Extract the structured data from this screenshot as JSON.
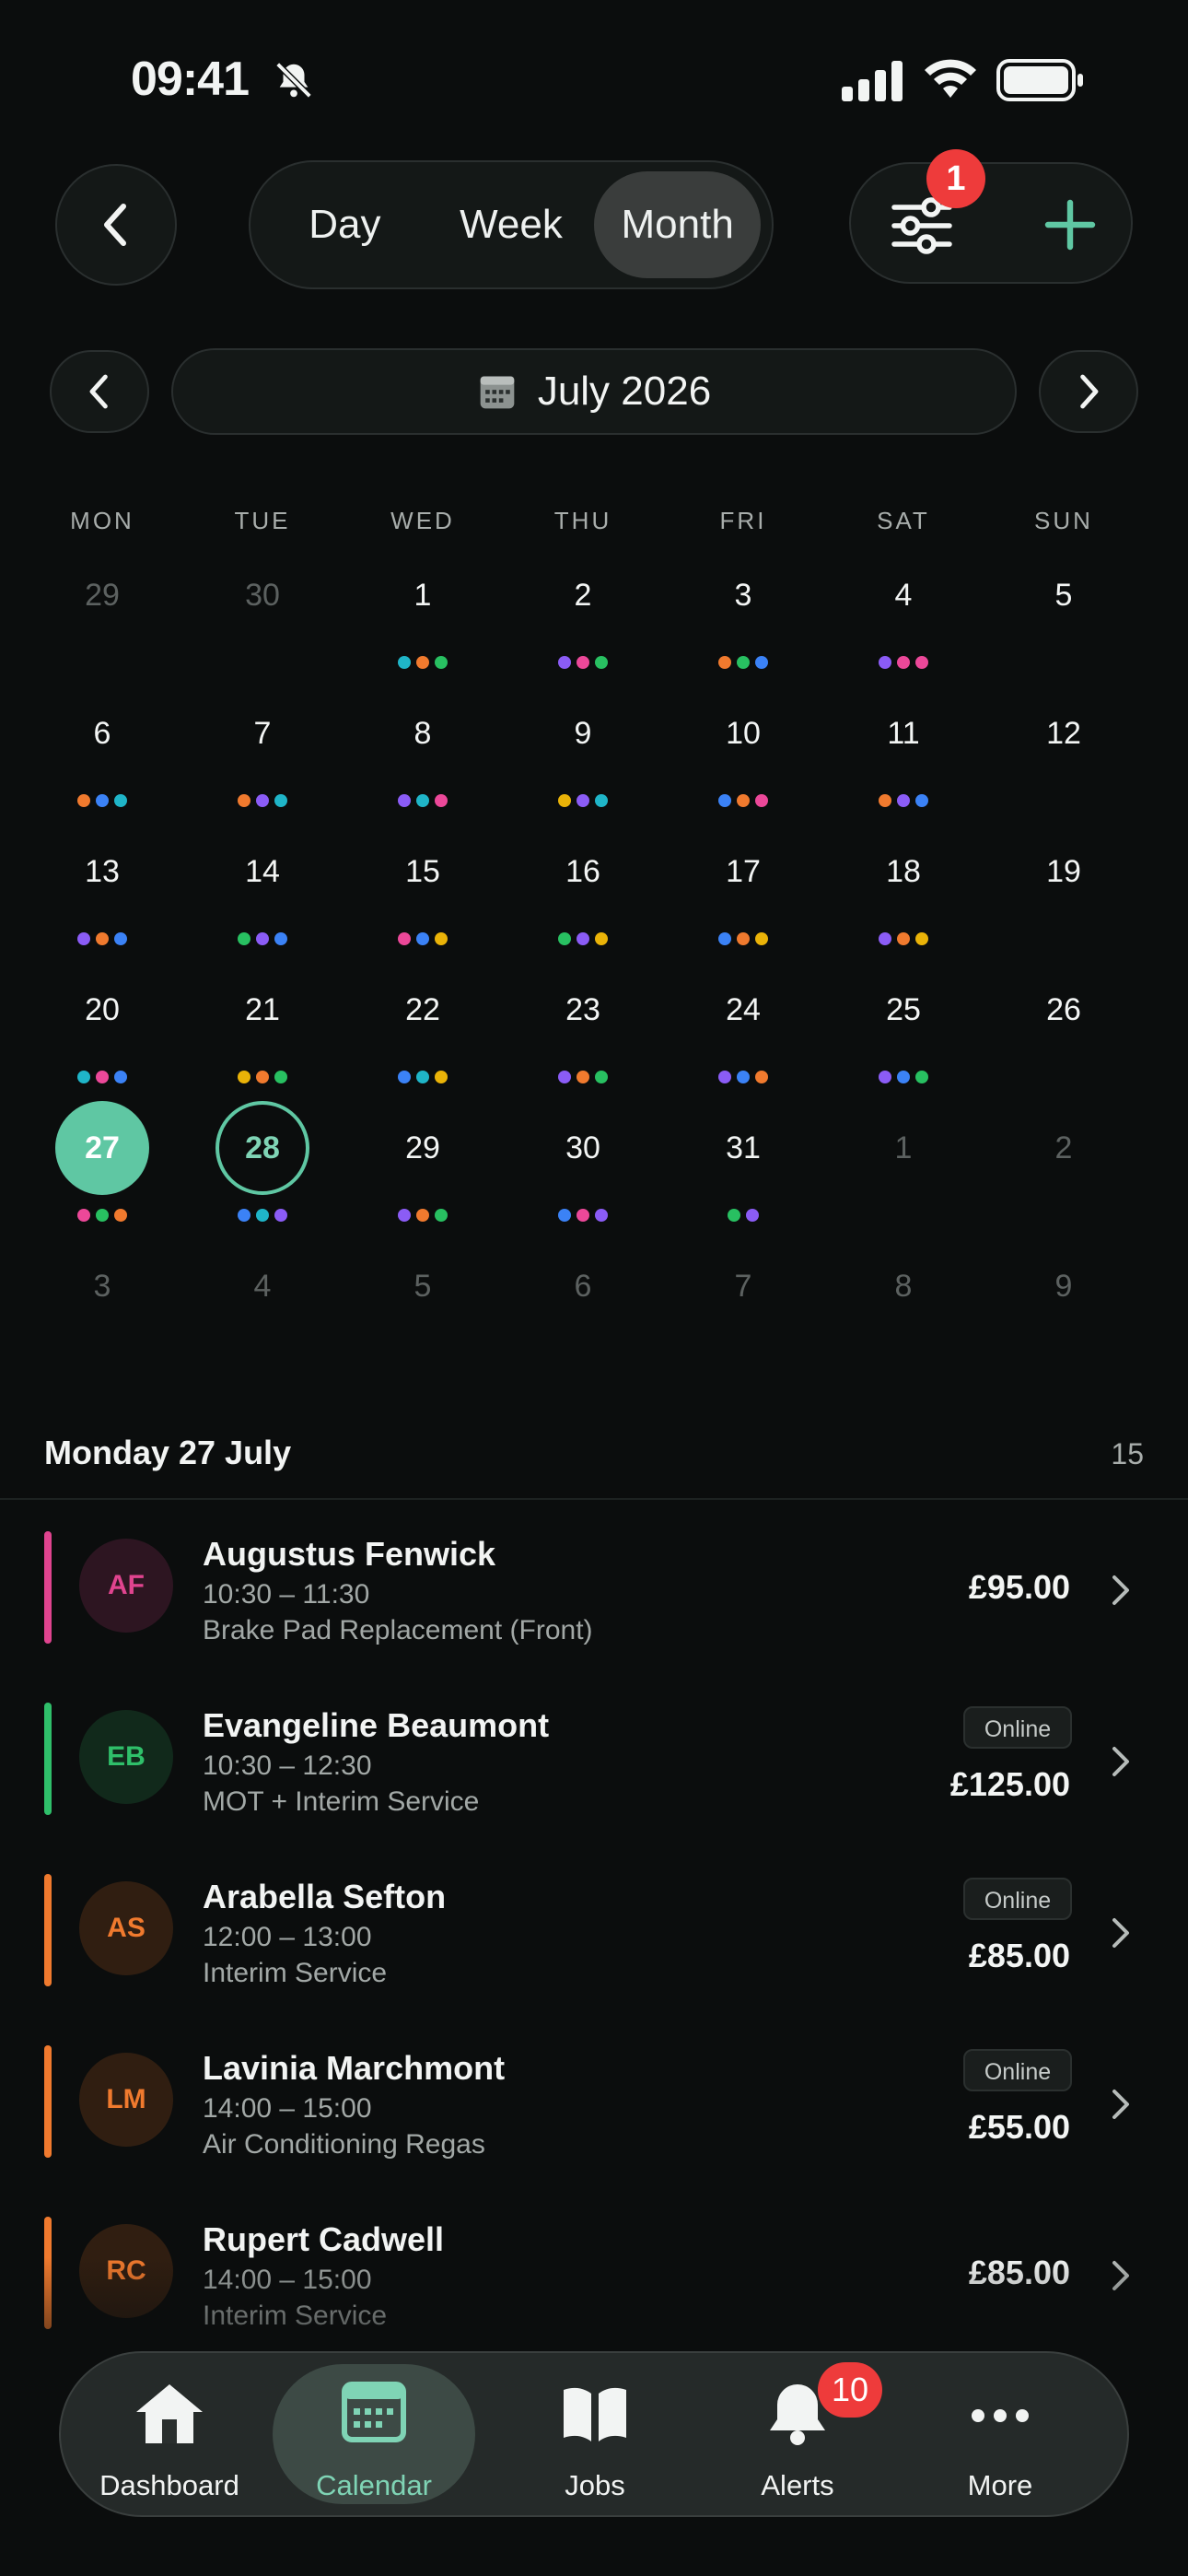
{
  "status": {
    "time": "09:41"
  },
  "header": {
    "segments": [
      {
        "label": "Day",
        "active": false
      },
      {
        "label": "Week",
        "active": false
      },
      {
        "label": "Month",
        "active": true
      }
    ],
    "filter_badge": "1"
  },
  "month_nav": {
    "title": "July 2026"
  },
  "calendar": {
    "weekdays": [
      "MON",
      "TUE",
      "WED",
      "THU",
      "FRI",
      "SAT",
      "SUN"
    ],
    "weeks": [
      [
        {
          "d": "29",
          "m": true,
          "dots": []
        },
        {
          "d": "30",
          "m": true,
          "dots": []
        },
        {
          "d": "1",
          "dots": [
            "#1fb5c8",
            "#f07a2e",
            "#28c061"
          ]
        },
        {
          "d": "2",
          "dots": [
            "#8b5cf6",
            "#ec4899",
            "#28c061"
          ]
        },
        {
          "d": "3",
          "dots": [
            "#f07a2e",
            "#28c061",
            "#3b82f6"
          ]
        },
        {
          "d": "4",
          "dots": [
            "#8b5cf6",
            "#ec4899",
            "#ec4899"
          ]
        },
        {
          "d": "5",
          "dots": []
        }
      ],
      [
        {
          "d": "6",
          "dots": [
            "#f07a2e",
            "#3b82f6",
            "#1fb5c8"
          ]
        },
        {
          "d": "7",
          "dots": [
            "#f07a2e",
            "#8b5cf6",
            "#1fb5c8"
          ]
        },
        {
          "d": "8",
          "dots": [
            "#8b5cf6",
            "#1fb5c8",
            "#ec4899"
          ]
        },
        {
          "d": "9",
          "dots": [
            "#eab308",
            "#8b5cf6",
            "#1fb5c8"
          ]
        },
        {
          "d": "10",
          "dots": [
            "#3b82f6",
            "#f07a2e",
            "#ec4899"
          ]
        },
        {
          "d": "11",
          "dots": [
            "#f07a2e",
            "#8b5cf6",
            "#3b82f6"
          ]
        },
        {
          "d": "12",
          "dots": []
        }
      ],
      [
        {
          "d": "13",
          "dots": [
            "#8b5cf6",
            "#f07a2e",
            "#3b82f6"
          ]
        },
        {
          "d": "14",
          "dots": [
            "#28c061",
            "#8b5cf6",
            "#3b82f6"
          ]
        },
        {
          "d": "15",
          "dots": [
            "#ec4899",
            "#3b82f6",
            "#eab308"
          ]
        },
        {
          "d": "16",
          "dots": [
            "#28c061",
            "#8b5cf6",
            "#eab308"
          ]
        },
        {
          "d": "17",
          "dots": [
            "#3b82f6",
            "#f07a2e",
            "#eab308"
          ]
        },
        {
          "d": "18",
          "dots": [
            "#8b5cf6",
            "#f07a2e",
            "#eab308"
          ]
        },
        {
          "d": "19",
          "dots": []
        }
      ],
      [
        {
          "d": "20",
          "dots": [
            "#1fb5c8",
            "#ec4899",
            "#3b82f6"
          ]
        },
        {
          "d": "21",
          "dots": [
            "#eab308",
            "#f07a2e",
            "#28c061"
          ]
        },
        {
          "d": "22",
          "dots": [
            "#3b82f6",
            "#1fb5c8",
            "#eab308"
          ]
        },
        {
          "d": "23",
          "dots": [
            "#8b5cf6",
            "#f07a2e",
            "#28c061"
          ]
        },
        {
          "d": "24",
          "dots": [
            "#8b5cf6",
            "#3b82f6",
            "#f07a2e"
          ]
        },
        {
          "d": "25",
          "dots": [
            "#8b5cf6",
            "#3b82f6",
            "#28c061"
          ]
        },
        {
          "d": "26",
          "dots": []
        }
      ],
      [
        {
          "d": "27",
          "today": true,
          "dots": [
            "#ec4899",
            "#28c061",
            "#f07a2e"
          ]
        },
        {
          "d": "28",
          "selected": true,
          "dots": [
            "#3b82f6",
            "#1fb5c8",
            "#8b5cf6"
          ]
        },
        {
          "d": "29",
          "dots": [
            "#8b5cf6",
            "#f07a2e",
            "#28c061"
          ]
        },
        {
          "d": "30",
          "dots": [
            "#3b82f6",
            "#ec4899",
            "#8b5cf6"
          ]
        },
        {
          "d": "31",
          "dots": [
            "#28c061",
            "#8b5cf6"
          ]
        },
        {
          "d": "1",
          "m": true,
          "dots": []
        },
        {
          "d": "2",
          "m": true,
          "dots": []
        }
      ],
      [
        {
          "d": "3",
          "m": true,
          "dots": []
        },
        {
          "d": "4",
          "m": true,
          "dots": []
        },
        {
          "d": "5",
          "m": true,
          "dots": []
        },
        {
          "d": "6",
          "m": true,
          "dots": []
        },
        {
          "d": "7",
          "m": true,
          "dots": []
        },
        {
          "d": "8",
          "m": true,
          "dots": []
        },
        {
          "d": "9",
          "m": true,
          "dots": []
        }
      ]
    ]
  },
  "day": {
    "title": "Monday 27 July",
    "count": "15"
  },
  "appointments": [
    {
      "initials": "AF",
      "name": "Augustus Fenwick",
      "time": "10:30 – 11:30",
      "service": "Brake Pad Replacement (Front)",
      "price": "£95.00",
      "online": "",
      "color": "#e0448f"
    },
    {
      "initials": "EB",
      "name": "Evangeline Beaumont",
      "time": "10:30 – 12:30",
      "service": "MOT + Interim Service",
      "price": "£125.00",
      "online": "Online",
      "color": "#2fbf6a"
    },
    {
      "initials": "AS",
      "name": "Arabella Sefton",
      "time": "12:00 – 13:00",
      "service": "Interim Service",
      "price": "£85.00",
      "online": "Online",
      "color": "#f07a2e"
    },
    {
      "initials": "LM",
      "name": "Lavinia Marchmont",
      "time": "14:00 – 15:00",
      "service": "Air Conditioning Regas",
      "price": "£55.00",
      "online": "Online",
      "color": "#f07a2e"
    },
    {
      "initials": "RC",
      "name": "Rupert Cadwell",
      "time": "14:00 – 15:00",
      "service": "Interim Service",
      "price": "£85.00",
      "online": "",
      "color": "#f07a2e"
    }
  ],
  "tabbar": {
    "items": [
      {
        "label": "Dashboard",
        "icon": "home-icon"
      },
      {
        "label": "Calendar",
        "icon": "calendar-icon",
        "active": true
      },
      {
        "label": "Jobs",
        "icon": "book-icon"
      },
      {
        "label": "Alerts",
        "icon": "bell-icon"
      },
      {
        "label": "More",
        "icon": "more-icon"
      }
    ],
    "alerts_badge": "10"
  }
}
